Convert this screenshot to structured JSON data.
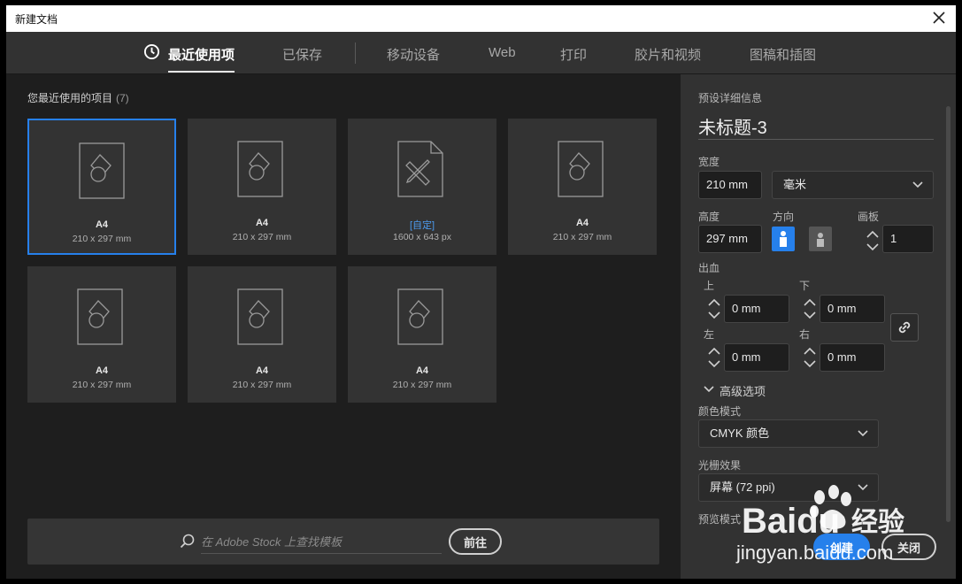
{
  "window": {
    "title": "新建文档"
  },
  "tabs": [
    {
      "label": "最近使用项",
      "active": true
    },
    {
      "label": "已保存"
    },
    {
      "label": "移动设备"
    },
    {
      "label": "Web"
    },
    {
      "label": "打印"
    },
    {
      "label": "胶片和视频"
    },
    {
      "label": "图稿和插图"
    }
  ],
  "recent": {
    "heading": "您最近使用的项目",
    "count": "(7)",
    "items": [
      {
        "name": "A4",
        "size": "210 x 297 mm",
        "icon": "document-shapes-icon",
        "selected": true
      },
      {
        "name": "A4",
        "size": "210 x 297 mm",
        "icon": "document-shapes-icon"
      },
      {
        "name": "[自定]",
        "size": "1600 x 643 px",
        "icon": "document-pencil-ruler-icon"
      },
      {
        "name": "A4",
        "size": "210 x 297 mm",
        "icon": "document-shapes-icon"
      },
      {
        "name": "A4",
        "size": "210 x 297 mm",
        "icon": "document-shapes-icon"
      },
      {
        "name": "A4",
        "size": "210 x 297 mm",
        "icon": "document-shapes-icon"
      },
      {
        "name": "A4",
        "size": "210 x 297 mm",
        "icon": "document-shapes-icon"
      }
    ]
  },
  "stock": {
    "placeholder": "在 Adobe Stock 上查找模板",
    "button": "前往"
  },
  "preset": {
    "heading": "预设详细信息",
    "name": "未标题-3",
    "width_label": "宽度",
    "width_value": "210 mm",
    "unit": "毫米",
    "height_label": "高度",
    "height_value": "297 mm",
    "orientation_label": "方向",
    "orientation": "portrait",
    "artboards_label": "画板",
    "artboards_value": "1",
    "bleed_label": "出血",
    "bleed_top_label": "上",
    "bleed_top": "0 mm",
    "bleed_bottom_label": "下",
    "bleed_bottom": "0 mm",
    "bleed_left_label": "左",
    "bleed_left": "0 mm",
    "bleed_right_label": "右",
    "bleed_right": "0 mm",
    "advanced_label": "高级选项",
    "color_mode_label": "颜色模式",
    "color_mode": "CMYK 颜色",
    "raster_label": "光栅效果",
    "raster": "屏幕 (72 ppi)",
    "preview_label": "预览模式"
  },
  "actions": {
    "create": "创建",
    "close": "关闭"
  },
  "watermark": {
    "brand": "Baidu",
    "brand_cn": "经验",
    "url": "jingyan.baidu.com"
  },
  "colors": {
    "accent": "#2680eb",
    "panel": "#323232",
    "background": "#1e1e1e"
  }
}
